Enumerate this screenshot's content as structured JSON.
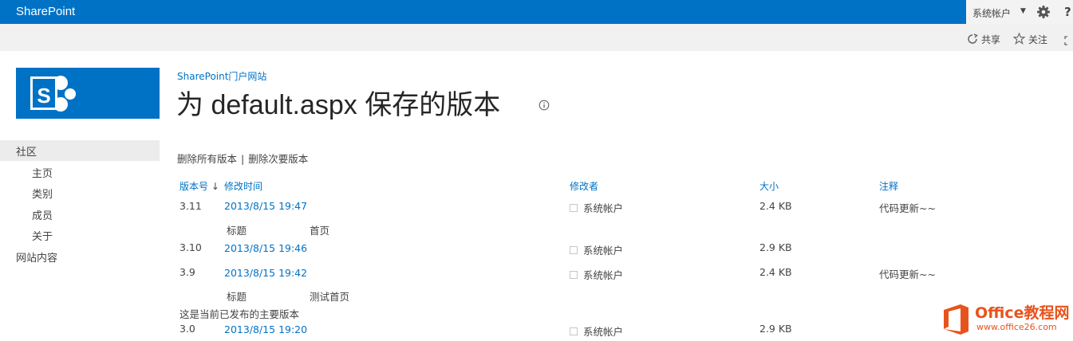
{
  "suite_bar": {
    "brand": "SharePoint",
    "account": "系统帐户",
    "accent": "#0072c6"
  },
  "ribbon": {
    "share": "共享",
    "follow": "关注"
  },
  "header": {
    "site_link": "SharePoint门户网站",
    "title": "为 default.aspx 保存的版本"
  },
  "nav": {
    "root": "社区",
    "items": [
      "主页",
      "类别",
      "成员",
      "关于"
    ],
    "site_contents": "网站内容"
  },
  "actions": {
    "delete_all": "删除所有版本",
    "separator": "|",
    "delete_minor": "删除次要版本"
  },
  "table": {
    "headers": {
      "version": "版本号",
      "sort_indicator": "↓",
      "modified": "修改时间",
      "modified_by": "修改者",
      "size": "大小",
      "comments": "注释"
    },
    "rows": [
      {
        "version": "3.11",
        "modified": "2013/8/15 19:47",
        "modified_by": "系统帐户",
        "size": "2.4 KB",
        "comment": "代码更新~~",
        "field_name": "标题",
        "field_value": "首页"
      },
      {
        "version": "3.10",
        "modified": "2013/8/15 19:46",
        "modified_by": "系统帐户",
        "size": "2.9 KB",
        "comment": ""
      },
      {
        "version": "3.9",
        "modified": "2013/8/15 19:42",
        "modified_by": "系统帐户",
        "size": "2.4 KB",
        "comment": "代码更新~~",
        "field_name": "标题",
        "field_value": "测试首页"
      },
      {
        "version": "3.0",
        "modified": "2013/8/15 19:20",
        "modified_by": "系统帐户",
        "size": "2.9 KB",
        "comment": ""
      }
    ],
    "published_note": "这是当前已发布的主要版本"
  },
  "watermark": {
    "title": "Office教程网",
    "url": "www.office26.com"
  }
}
